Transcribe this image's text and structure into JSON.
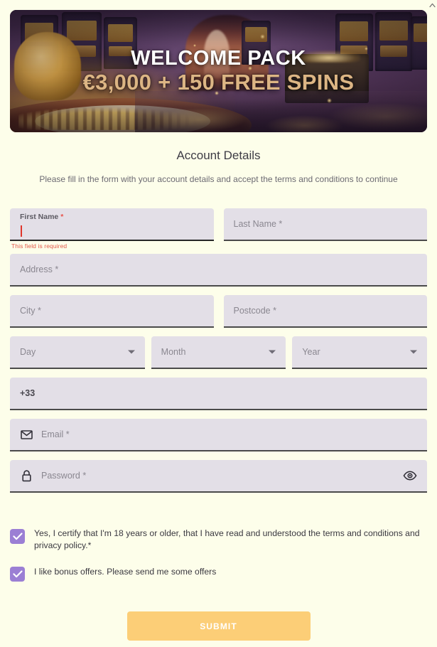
{
  "banner": {
    "line1": "WELCOME PACK",
    "line2": "€3,000 + 150 FREE SPINS",
    "gold_color": "#dcb584",
    "white_color": "#ffffff"
  },
  "heading": {
    "title": "Account Details",
    "subtitle": "Please fill in the form with your account details and accept the terms and conditions to continue"
  },
  "form": {
    "first_name": {
      "label": "First Name",
      "required_star": "*",
      "value": "",
      "error": "This field is required"
    },
    "last_name": {
      "placeholder": "Last Name *"
    },
    "address": {
      "placeholder": "Address *"
    },
    "city": {
      "placeholder": "City *"
    },
    "postcode": {
      "placeholder": "Postcode *"
    },
    "day": {
      "placeholder": "Day"
    },
    "month": {
      "placeholder": "Month"
    },
    "year": {
      "placeholder": "Year"
    },
    "phone": {
      "value": "+33"
    },
    "email": {
      "placeholder": "Email *"
    },
    "password": {
      "placeholder": "Password *"
    }
  },
  "consents": [
    {
      "label": "Yes, I certify that I'm 18 years or older, that I have read and understood the terms and conditions and privacy policy.*",
      "checked": true
    },
    {
      "label": "I like bonus offers. Please send me some offers",
      "checked": true
    }
  ],
  "submit": {
    "label": "SUBMIT",
    "color": "#fcce77"
  },
  "colors": {
    "page_background": "#fdfeea",
    "field_background": "#e3dfe7",
    "field_underline": "#4a4a4a",
    "checkbox": "#9b7fd4",
    "error": "#e2594b",
    "caret": "#e0352b"
  }
}
